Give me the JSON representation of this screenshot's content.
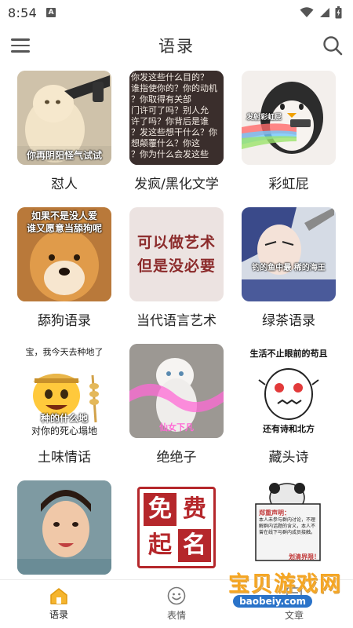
{
  "status_bar": {
    "time": "8:54",
    "notification_icon": "a-icon",
    "icons": [
      "wifi-icon",
      "signal-icon",
      "battery-icon"
    ]
  },
  "app_bar": {
    "title": "语录",
    "menu_icon": "hamburger-menu-icon",
    "search_icon": "search-icon"
  },
  "categories": [
    {
      "label": "怼人",
      "thumb_caption": "你再阴阳怪气试试"
    },
    {
      "label": "发疯/黑化文学",
      "thumb_caption": ""
    },
    {
      "label": "彩虹屁",
      "thumb_caption": "发射彩虹屁"
    },
    {
      "label": "舔狗语录",
      "thumb_caption_1": "如果不是没人爱",
      "thumb_caption_2": "谁又愿意当舔狗呢"
    },
    {
      "label": "当代语言艺术",
      "thumb_caption_1": "可以做艺术",
      "thumb_caption_2": "但是没必要"
    },
    {
      "label": "绿茶语录",
      "thumb_caption": "钓的鱼中最 稀的海王"
    },
    {
      "label": "土味情话",
      "thumb_caption_1": "宝，我今天去种地了",
      "thumb_caption_2": "种的什么地",
      "thumb_caption_3": "对你的死心塌地"
    },
    {
      "label": "绝绝子",
      "thumb_caption": "仙女下凡"
    },
    {
      "label": "藏头诗",
      "thumb_caption_1": "生活不止眼前的苟且",
      "thumb_caption_2": "还有诗和北方"
    },
    {
      "label": "",
      "thumb_caption": ""
    },
    {
      "label": "",
      "thumb_caption_1": "免",
      "thumb_caption_2": "费",
      "thumb_caption_3": "起",
      "thumb_caption_4": "名"
    },
    {
      "label": "",
      "thumb_caption_1": "郑重声明：",
      "thumb_caption_2": "本人未参与群内讨论，不理解群内话题的含义，本人不曾在线下与群内成员接触。",
      "thumb_caption_3": "划清界限！"
    }
  ],
  "bottom_nav": [
    {
      "label": "语录",
      "icon": "home-icon",
      "active": true
    },
    {
      "label": "表情",
      "icon": "smiley-icon",
      "active": false
    },
    {
      "label": "文章",
      "icon": "article-icon",
      "active": false
    }
  ],
  "watermark": {
    "title": "宝贝游戏网",
    "url": "baobeiy.com"
  },
  "colors": {
    "accent": "#f0a81c",
    "text": "#222222",
    "divider": "#eaeaea"
  }
}
